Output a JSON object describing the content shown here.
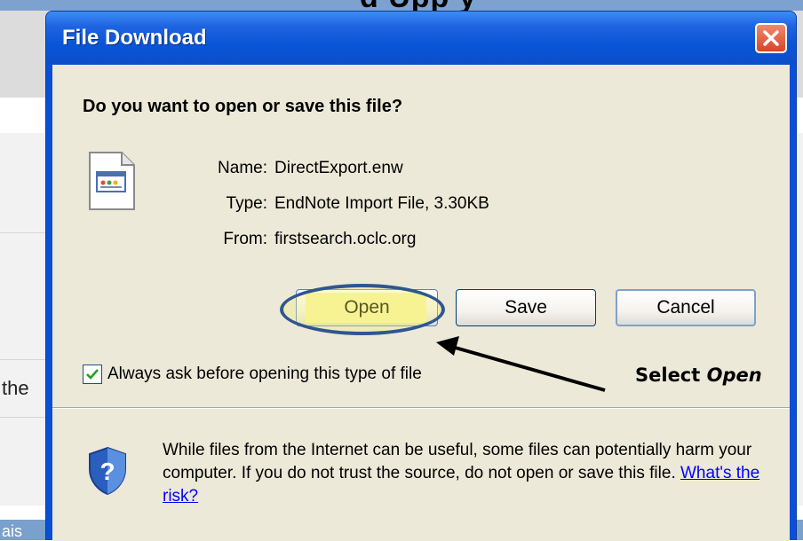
{
  "background": {
    "heading_fragment": "d    Upp          y",
    "side_text": "the",
    "bottom_text": "ais"
  },
  "dialog": {
    "title": "File Download",
    "question": "Do you want to open or save this file?",
    "file": {
      "name_label": "Name:",
      "name_value": "DirectExport.enw",
      "type_label": "Type:",
      "type_value": "EndNote Import File, 3.30KB",
      "from_label": "From:",
      "from_value": "firstsearch.oclc.org",
      "icon": "document-file-icon"
    },
    "buttons": {
      "open": "Open",
      "save": "Save",
      "cancel": "Cancel"
    },
    "checkbox": {
      "label": "Always ask before opening this type of file",
      "checked": true
    },
    "warning": {
      "text": "While files from the Internet can be useful, some files can potentially harm your computer. If you do not trust the source, do not open or save this file.",
      "link": "What's the risk?",
      "icon": "shield-question-icon"
    }
  },
  "annotation": {
    "prefix": "Select",
    "emphasis": "Open",
    "highlight_color": "#f7f5a0",
    "ellipse_color": "#2f568f"
  },
  "colors": {
    "titlebar": "#0a55d8",
    "client_bg": "#ece9d8",
    "close_button": "#d9442a",
    "link": "#0000ff"
  }
}
